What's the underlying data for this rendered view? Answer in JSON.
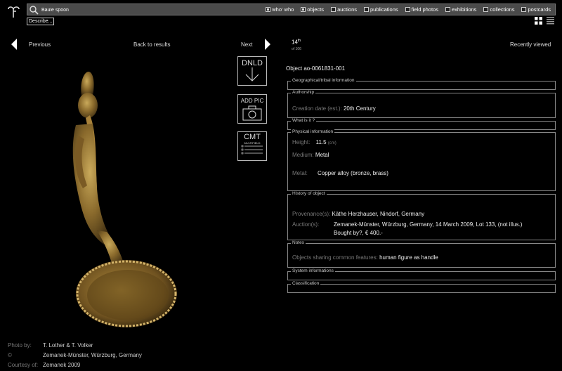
{
  "search": {
    "value": "Baule spoon"
  },
  "filters": [
    {
      "label": "who' who",
      "checked": true
    },
    {
      "label": "objects",
      "checked": true
    },
    {
      "label": "auctions",
      "checked": false
    },
    {
      "label": "publications",
      "checked": false
    },
    {
      "label": "field photos",
      "checked": false
    },
    {
      "label": "exhibitions",
      "checked": false
    },
    {
      "label": "collections",
      "checked": false
    },
    {
      "label": "postcards",
      "checked": false
    }
  ],
  "describe_label": "Describe...",
  "nav": {
    "previous": "Previous",
    "back": "Back to results",
    "next": "Next"
  },
  "counter": {
    "position": "14",
    "suffix": "th",
    "total": "of 106"
  },
  "recently_viewed": "Recently viewed",
  "actions": {
    "download": "DNLD",
    "add_pic": "ADD PIC",
    "comment": "CMT",
    "comment_sub": "MULTIFIELD"
  },
  "object_id": "Object ao-0061831-001",
  "sections": {
    "geo": "Geographical/tribal information",
    "authorship": {
      "title": "Authorship",
      "creation_label": "Creation date (est.):",
      "creation_value": "20th Century"
    },
    "what": "What is it ?",
    "physical": {
      "title": "Physical information",
      "height_label": "Height:",
      "height_value": "11.5",
      "height_unit": "(cm)",
      "medium_label": "Medium:",
      "medium_value": "Metal",
      "metal_label": "Metal:",
      "metal_value": "Copper alloy (bronze, brass)"
    },
    "history": {
      "title": "History of object",
      "provenance_label": "Provenance(s):",
      "provenance_value": "Käthe Herzhauser, Nindorf, Germany",
      "auction_label": "Auction(s):",
      "auction_line1": "Zemanek-Münster, Würzburg, Germany, 14 March 2009, Lot 133, (not illus.)",
      "auction_line2": "Bought by?, € 400.-"
    },
    "notes": {
      "title": "Notes",
      "shared_label": "Objects sharing common features:",
      "shared_value": "human figure as handle"
    },
    "system": "System informations",
    "classification": "Classification"
  },
  "credits": {
    "photo_label": "Photo by:",
    "photo_value": "T. Lother & T. Volker",
    "copyright_label": "©",
    "copyright_value": "Zemanek-Münster, Würzburg, Germany",
    "courtesy_label": "Courtesy of:",
    "courtesy_value": "Zemanek 2009"
  }
}
